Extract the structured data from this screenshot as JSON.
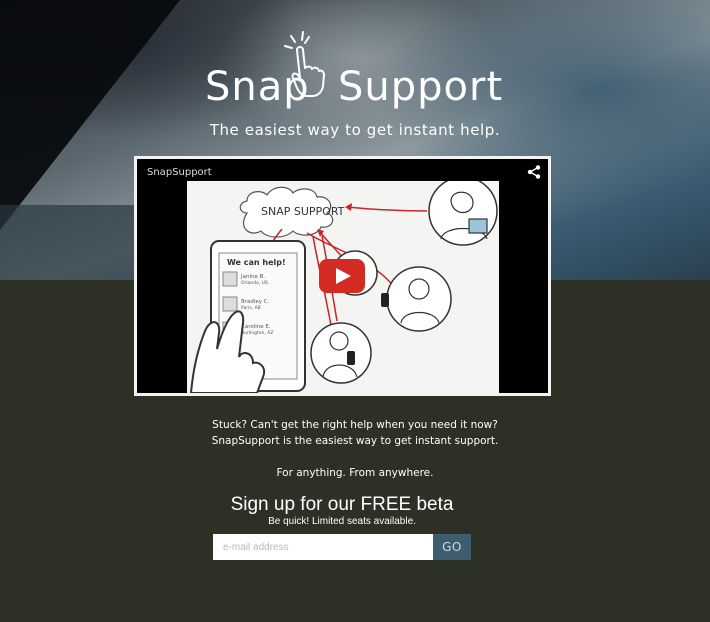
{
  "brand": {
    "name_left": "Snap",
    "name_right": "Support",
    "tagline": "The easiest way to get instant help."
  },
  "video": {
    "channel_title": "SnapSupport",
    "cloud_text": "SNAP SUPPORT",
    "phone_header": "We can help!",
    "phone_contacts": [
      {
        "name": "Janine B.",
        "location": "Orlando, US"
      },
      {
        "name": "Bradley C.",
        "location": "Paris, AB"
      },
      {
        "name": "Caroline E.",
        "location": "Burlington, AZ"
      }
    ],
    "play_icon": "play-icon",
    "share_icon": "share-icon"
  },
  "description": {
    "line1": "Stuck? Can't get the right help when you need it now?",
    "line2": "SnapSupport is the easiest way to get instant support.",
    "line3": "For anything. From anywhere."
  },
  "signup": {
    "title": "Sign up for our FREE beta",
    "subtitle": "Be quick! Limited seats available.",
    "email_placeholder": "e-mail address",
    "go_label": "GO"
  },
  "colors": {
    "background": "#2c3025",
    "play_button": "#d42a24",
    "go_button": "#3e5d70"
  }
}
